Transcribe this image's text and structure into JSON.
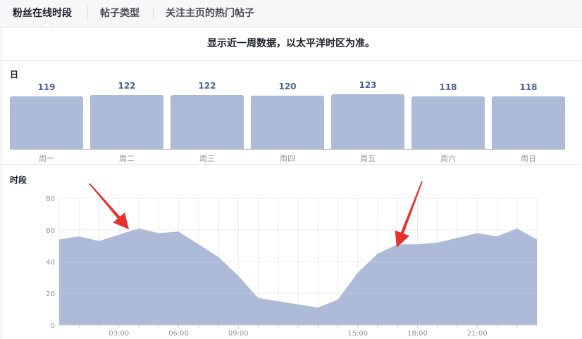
{
  "tabs": [
    {
      "label": "粉丝在线时段",
      "active": true
    },
    {
      "label": "帖子类型",
      "active": false
    },
    {
      "label": "关注主页的热门帖子",
      "active": false
    }
  ],
  "notice": "显示近一周数据，以太平洋时区为准。",
  "days_section": {
    "title": "日",
    "days": [
      {
        "label": "周一",
        "value": 119
      },
      {
        "label": "周二",
        "value": 122
      },
      {
        "label": "周三",
        "value": 122
      },
      {
        "label": "周四",
        "value": 120
      },
      {
        "label": "周五",
        "value": 123
      },
      {
        "label": "周六",
        "value": 118
      },
      {
        "label": "周日",
        "value": 118
      }
    ]
  },
  "hours_section": {
    "title": "时段"
  },
  "chart_data": {
    "type": "area",
    "x": [
      0,
      1,
      2,
      3,
      4,
      5,
      6,
      7,
      8,
      9,
      10,
      11,
      12,
      13,
      14,
      15,
      16,
      17,
      18,
      19,
      20,
      21,
      22,
      23,
      24
    ],
    "values": [
      54,
      56,
      53,
      57,
      61,
      58,
      59,
      51,
      43,
      31,
      17,
      15,
      13,
      11,
      16,
      33,
      45,
      51,
      51,
      52,
      55,
      58,
      56,
      61,
      54
    ],
    "ylim": [
      0,
      80
    ],
    "yticks": [
      0,
      20,
      40,
      60,
      80
    ],
    "ytick_labels": [
      "0",
      "20",
      "40",
      "60",
      "80"
    ],
    "xtick_positions": [
      3,
      6,
      9,
      15,
      18,
      21
    ],
    "xtick_labels": [
      "03:00",
      "06:00",
      "09:00",
      "15:00",
      "18:00",
      "21:00"
    ],
    "grid": true,
    "title": "",
    "xlabel": "",
    "ylabel": "",
    "fill_color": "#aebbd8",
    "annotations": [
      {
        "type": "red-arrow",
        "points_to_hour": 3.5
      },
      {
        "type": "red-arrow",
        "points_to_hour": 16.5
      }
    ]
  },
  "colors": {
    "bar": "#aebbd8",
    "value_text": "#4c6196",
    "arrow": "#e8312f"
  }
}
